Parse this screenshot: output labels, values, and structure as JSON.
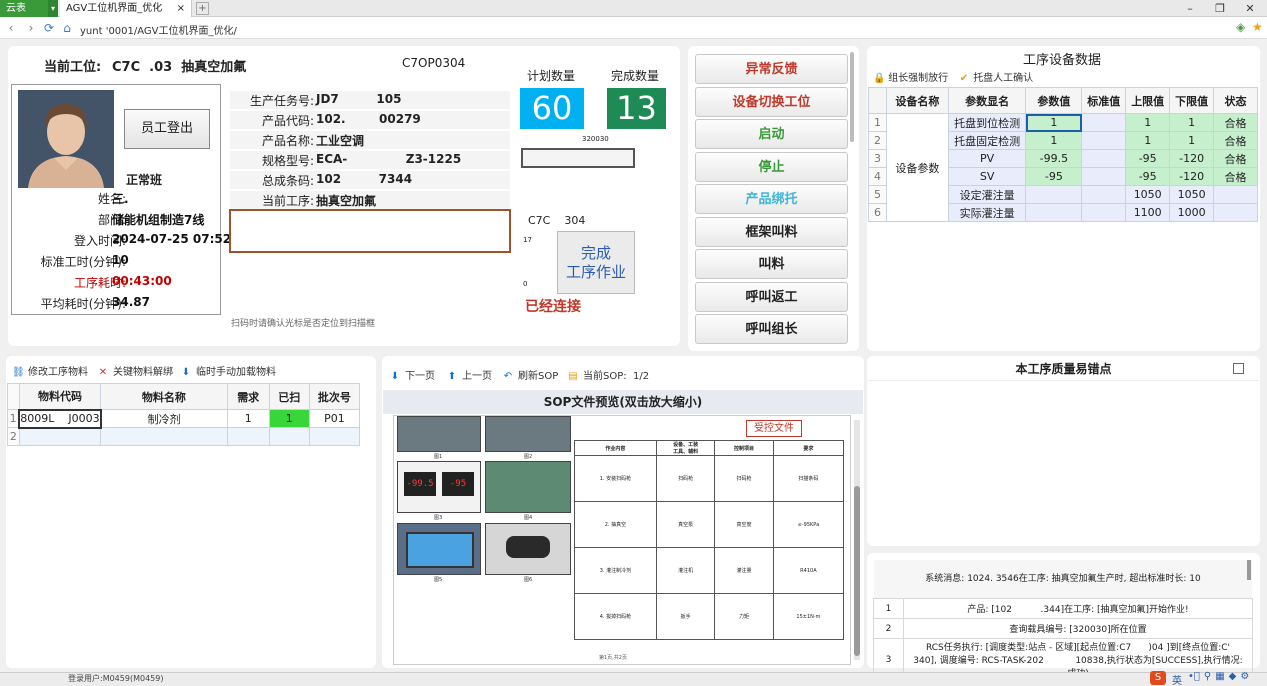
{
  "browser": {
    "brand": "云表",
    "tab_title": "AGV工位机界面_优化",
    "tab_close": "×",
    "tab_add": "+",
    "url": "yunt                '0001/AGV工位机界面_优化/"
  },
  "header": {
    "station_label": "当前工位:",
    "station_value": "C7C  .03  抽真空加氟",
    "station_code": "C7OP0304"
  },
  "employee": {
    "logout_label": "员工登出",
    "shift": "正常班",
    "fields": [
      {
        "label": "姓名:",
        "value": "三.",
        "value_color": "#111",
        "label_color": "#222"
      },
      {
        "label": "部门:",
        "value": "储能机组制造7线",
        "value_color": "#111",
        "label_color": "#222"
      },
      {
        "label": "登入时间:",
        "value": "2024-07-25 07:52",
        "value_color": "#111",
        "label_color": "#222"
      },
      {
        "label": "标准工时(分钟):",
        "value": "10",
        "value_color": "#111",
        "label_color": "#222"
      },
      {
        "label": "工序耗时:",
        "value": "00:43:00",
        "value_color": "#c00000",
        "label_color": "#c00000"
      },
      {
        "label": "平均耗时(分钟):",
        "value": "34.87",
        "value_color": "#111",
        "label_color": "#222"
      }
    ]
  },
  "task": {
    "fields": [
      {
        "label": "生产任务号:",
        "value": "JD7         105"
      },
      {
        "label": "产品代码:",
        "value": "102.        00279"
      },
      {
        "label": "产品名称:",
        "value": "工业空调"
      },
      {
        "label": "规格型号:",
        "value": "ECA-              Z3-1225"
      },
      {
        "label": "总成条码:",
        "value": "102         7344"
      },
      {
        "label": "当前工序:",
        "value": "抽真空加氟"
      }
    ],
    "scan_hint": "扫码时请确认光标是否定位到扫描框"
  },
  "counts": {
    "plan_label": "计划数量",
    "plan_value": "60",
    "done_label": "完成数量",
    "done_value": "13",
    "small_code": "320030",
    "op_code": "C7C    304",
    "axis_top": "17",
    "axis_bottom": "0",
    "complete_btn": "完成\n工序作业",
    "connection_status": "已经连接"
  },
  "actions": [
    "异常反馈",
    "设备切换工位",
    "启动",
    "停止",
    "产品绑托",
    "框架叫料",
    "叫料",
    "呼叫返工",
    "呼叫组长"
  ],
  "action_colors": [
    "#c0392b",
    "#c0392b",
    "#3a9a3a",
    "#3a9a3a",
    "#3fb6d8",
    "#222",
    "#222",
    "#222",
    "#222"
  ],
  "device": {
    "title": "工序设备数据",
    "btn_release": "组长强制放行",
    "btn_confirm": "托盘人工确认",
    "headers": [
      "设备名称",
      "参数显名",
      "参数值",
      "标准值",
      "上限值",
      "下限值",
      "状态"
    ],
    "group_name": "设备参数",
    "rows": [
      {
        "n": "1",
        "name": "托盘到位检测",
        "value": "1",
        "std": "",
        "upper": "1",
        "lower": "1",
        "status": "合格"
      },
      {
        "n": "2",
        "name": "托盘固定检测",
        "value": "1",
        "std": "",
        "upper": "1",
        "lower": "1",
        "status": "合格"
      },
      {
        "n": "3",
        "name": "PV",
        "value": "-99.5",
        "std": "",
        "upper": "-95",
        "lower": "-120",
        "status": "合格"
      },
      {
        "n": "4",
        "name": "SV",
        "value": "-95",
        "std": "",
        "upper": "-95",
        "lower": "-120",
        "status": "合格"
      },
      {
        "n": "5",
        "name": "设定灌注量",
        "value": "",
        "std": "",
        "upper": "1050",
        "lower": "1050",
        "status": ""
      },
      {
        "n": "6",
        "name": "实际灌注量",
        "value": "",
        "std": "",
        "upper": "1100",
        "lower": "1000",
        "status": ""
      }
    ]
  },
  "materials": {
    "tools": [
      "修改工序物料",
      "关键物料解绑",
      "临时手动加载物料"
    ],
    "headers": [
      "物料代码",
      "物料名称",
      "需求",
      "已扫",
      "批次号"
    ],
    "rows": [
      {
        "n": "1",
        "code": "8009L    J0003",
        "name": "制冷剂",
        "need": "1",
        "scanned": "1",
        "batch": "P01"
      },
      {
        "n": "2",
        "code": "",
        "name": "",
        "need": "",
        "scanned": "",
        "batch": ""
      }
    ]
  },
  "sop": {
    "tools": [
      "下一页",
      "上一页",
      "刷新SOP",
      "当前SOP:  1/2"
    ],
    "title": "SOP文件预览(双击放大缩小)",
    "stamp": "受控文件",
    "photo_labels": [
      "图1",
      "图2",
      "图3",
      "图4",
      "图5",
      "图6"
    ],
    "col_headers": [
      "作业内容",
      "设备、工装\n工具、辅料",
      "控制项目",
      "要求"
    ],
    "steps": [
      {
        "content": "1. 安装扫码枪",
        "tool": "扫码枪",
        "item": "扫码枪",
        "req": "扫描条码"
      },
      {
        "content": "2. 抽真空",
        "tool": "真空泵",
        "item": "真空度",
        "req": "≤-95KPa"
      },
      {
        "content": "3. 灌注制冷剂",
        "tool": "灌注机",
        "item": "灌注量",
        "req": "R410A"
      },
      {
        "content": "4. 拔掉扫码枪",
        "tool": "扳手",
        "item": "力矩",
        "req": "15±1N·m"
      }
    ],
    "footer": "第1页,共2页"
  },
  "quality": {
    "title": "本工序质量易错点"
  },
  "messages": {
    "system": "系统消息: 1024.         3546在工序: 抽真空加氟生产时, 超出标准时长: 10",
    "rows": [
      {
        "n": "1",
        "text": "产品: [102          .344]在工序: [抽真空加氟]开始作业!"
      },
      {
        "n": "2",
        "text": "查询载具编号: [320030]所在位置"
      },
      {
        "n": "3",
        "text": "RCS任务执行: [调度类型:站点 - 区域][起点位置:C7      )04 ]到[终点位置:C'       340], 调度编号: RCS-TASK-202           10838,执行状态为[SUCCESS],执行情况: 成功)"
      }
    ]
  },
  "status": {
    "login_user": "登录用户:M0459(M0459)",
    "ime": "英"
  },
  "colors": {
    "plan_bg": "#00b0f0",
    "done_bg": "#1e8a55",
    "green_cell": "#c6efce",
    "scan_ok": "#39d63a"
  }
}
